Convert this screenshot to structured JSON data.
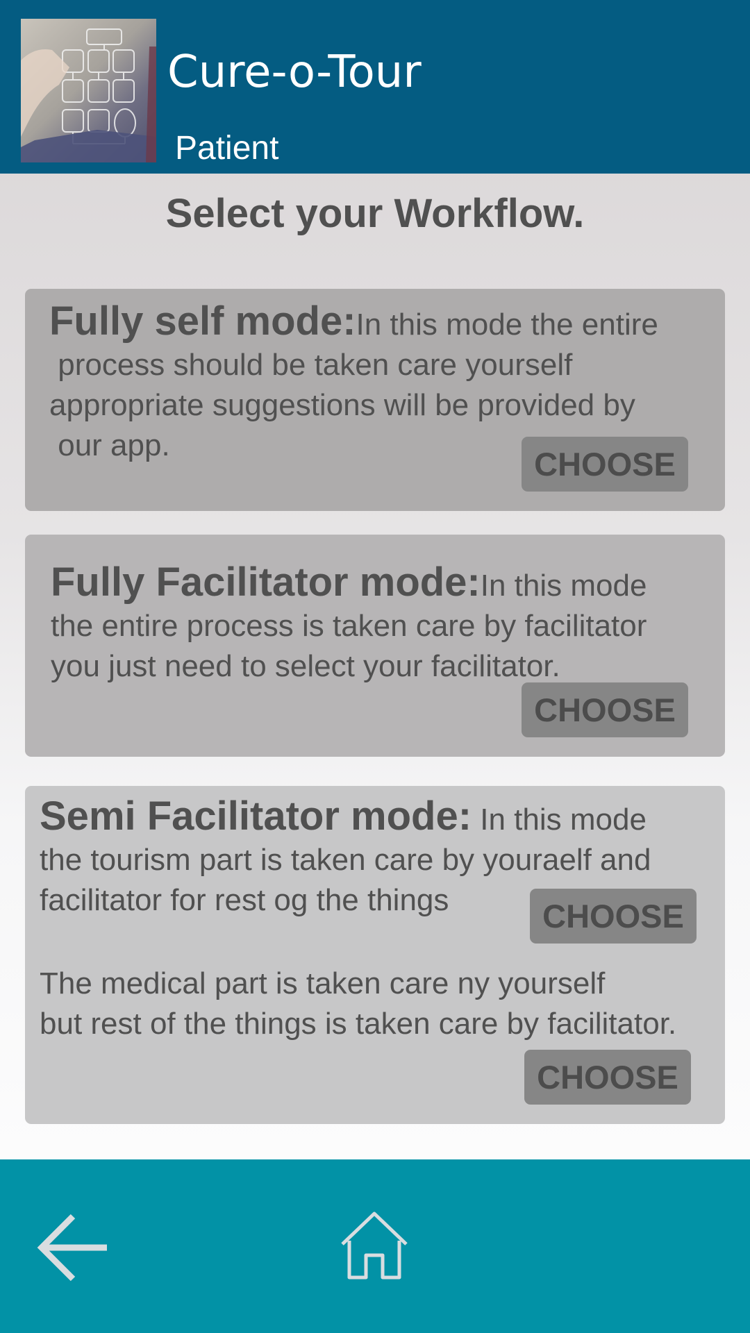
{
  "header": {
    "app_title": "Cure-o-Tour",
    "user_role": "Patient",
    "background_color": "#045c82"
  },
  "main": {
    "title": "Select your Workflow.",
    "cards": [
      {
        "mode_name": "Fully self mode:",
        "description": "In this mode the entire\n process should be taken care yourself\nappropriate suggestions will be provided by\n our app.",
        "choose_label": "CHOOSE"
      },
      {
        "mode_name": "Fully Facilitator mode:",
        "description": "In this mode\nthe entire process is taken care by facilitator\nyou just need to select your facilitator.",
        "choose_label": "CHOOSE"
      },
      {
        "mode_name": "Semi Facilitator mode:",
        "description": " In this mode\nthe tourism part is taken care by youraelf and\nfacilitator for rest og the things",
        "choose_label": "CHOOSE",
        "secondary_description": "The medical part is taken care ny yourself\nbut rest of the things is taken care by facilitator.",
        "secondary_choose_label": "CHOOSE"
      }
    ]
  },
  "footer": {
    "back_icon": "arrow-left-icon",
    "home_icon": "home-icon",
    "background_color": "#0292a6"
  }
}
